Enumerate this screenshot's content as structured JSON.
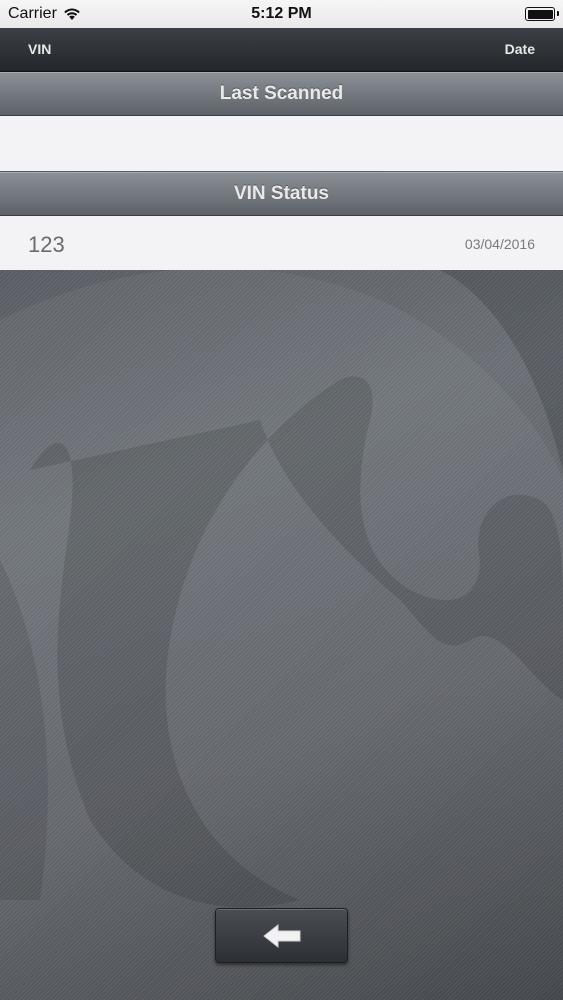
{
  "status_bar": {
    "carrier": "Carrier",
    "time": "5:12 PM",
    "wifi_icon": "wifi-icon",
    "battery_icon": "battery-icon"
  },
  "header": {
    "left_label": "VIN",
    "right_label": "Date"
  },
  "sections": {
    "last_scanned": {
      "title": "Last Scanned",
      "value": ""
    },
    "vin_status": {
      "title": "VIN Status",
      "rows": [
        {
          "vin": "123",
          "date": "03/04/2016"
        }
      ]
    }
  },
  "footer": {
    "back_icon": "arrow-left-icon"
  },
  "colors": {
    "header_bar": "#2e3136",
    "section_header": "#72777d",
    "row_background": "#f3f3f5",
    "background": "#5f6369"
  }
}
